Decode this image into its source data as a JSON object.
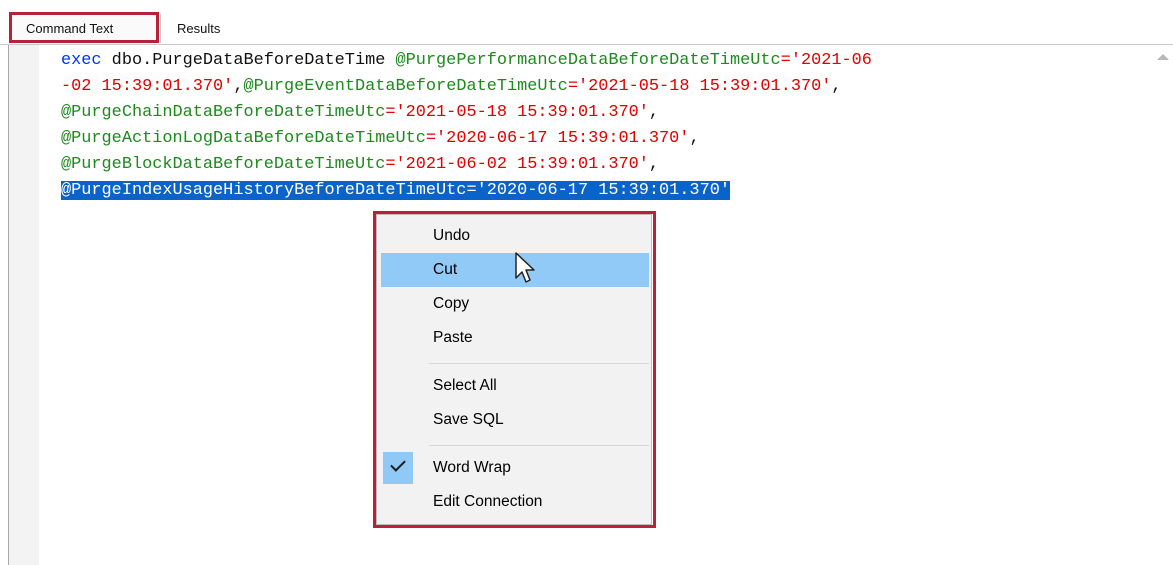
{
  "tabs": {
    "command_text": "Command Text",
    "results": "Results"
  },
  "code": {
    "line1": {
      "kw": "exec",
      "proc": " dbo.PurgeDataBeforeDateTime ",
      "p1": "@PurgePerformanceDataBeforeDateTimeUtc",
      "eq": "=",
      "v1_start": "'2021-06"
    },
    "line2": {
      "v1_end": "-02 15:39:01.370'",
      "comma1": ",",
      "p2": "@PurgeEventDataBeforeDateTimeUtc",
      "eq": "=",
      "v2": "'2021-05-18 15:39:01.370'",
      "comma": ","
    },
    "line3": {
      "p3": "@PurgeChainDataBeforeDateTimeUtc",
      "eq": "=",
      "v3": "'2021-05-18 15:39:01.370'",
      "comma": ","
    },
    "line4": {
      "p4": "@PurgeActionLogDataBeforeDateTimeUtc",
      "eq": "=",
      "v4": "'2020-06-17 15:39:01.370'",
      "comma": ","
    },
    "line5": {
      "p5": "@PurgeBlockDataBeforeDateTimeUtc",
      "eq": "=",
      "v5": "'2021-06-02 15:39:01.370'",
      "comma": ","
    },
    "line6": {
      "selected": "@PurgeIndexUsageHistoryBeforeDateTimeUtc='2020-06-17 15:39:01.370'"
    }
  },
  "context_menu": {
    "items": [
      "Undo",
      "Cut",
      "Copy",
      "Paste",
      "Select All",
      "Save SQL",
      "Word Wrap",
      "Edit Connection"
    ],
    "hovered_item": "Cut",
    "checked_item": "Word Wrap"
  },
  "colors": {
    "keyword": "#0033ff",
    "parameter": "#1d8a1d",
    "string": "#e00000",
    "selection": "#0a63c9",
    "menu_hover": "#91c9f7",
    "annotation_outline": "#b8213a"
  },
  "icons": {
    "scroll_up": "scroll-up-arrow-icon",
    "check": "checkmark-icon",
    "cursor": "mouse-pointer-icon"
  }
}
